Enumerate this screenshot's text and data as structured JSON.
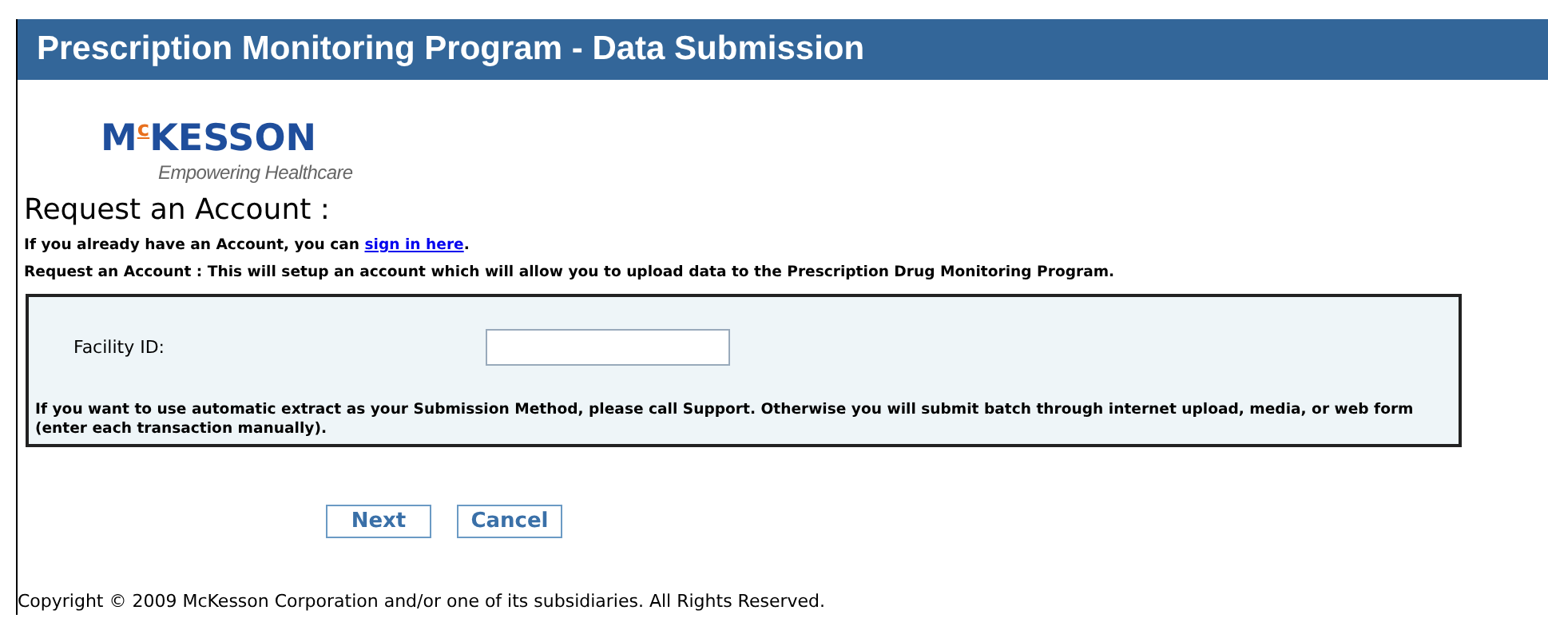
{
  "header": {
    "title": "Prescription Monitoring Program - Data Submission"
  },
  "logo": {
    "first": "M",
    "raised": "c",
    "rest": "KESSON",
    "tagline": "Empowering Healthcare"
  },
  "heading": "Request an Account :",
  "signin": {
    "before": "If you already have an Account, you can ",
    "link": "sign in here",
    "after": "."
  },
  "intro": "Request an Account : This will setup an account which will allow you to upload data to the Prescription Drug Monitoring Program.",
  "form": {
    "fields": [
      {
        "label": "Facility ID:"
      }
    ],
    "note": "If you want to use automatic extract as your Submission Method, please call Support. Otherwise you will submit batch through internet upload, media, or web form (enter each transaction manually)."
  },
  "buttons": [
    "Next",
    "Cancel"
  ],
  "footer": "Copyright © 2009 McKesson Corporation and/or one of its subsidiaries. All Rights Reserved."
}
